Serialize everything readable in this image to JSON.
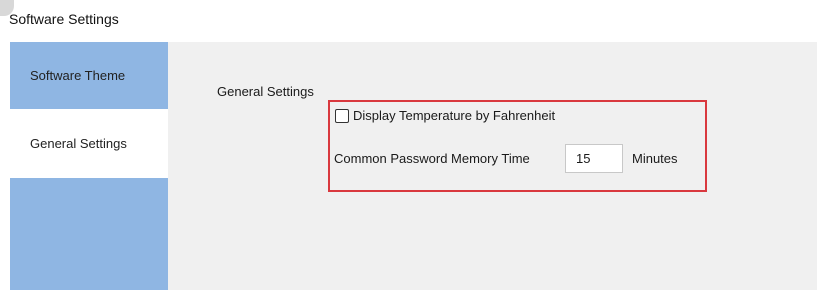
{
  "window": {
    "title": "Software Settings"
  },
  "sidebar": {
    "items": [
      {
        "label": "Software Theme"
      },
      {
        "label": "General Settings"
      }
    ]
  },
  "general": {
    "section_label": "General Settings",
    "fahrenheit_checkbox": {
      "label": "Display Temperature by Fahrenheit",
      "checked": false
    },
    "password_memory": {
      "label": "Common Password Memory Time",
      "value": "15",
      "unit": "Minutes"
    }
  },
  "colors": {
    "sidebar": "#8fb6e3",
    "highlight_border": "#d9383e",
    "content_bg": "#f0f0f0"
  }
}
